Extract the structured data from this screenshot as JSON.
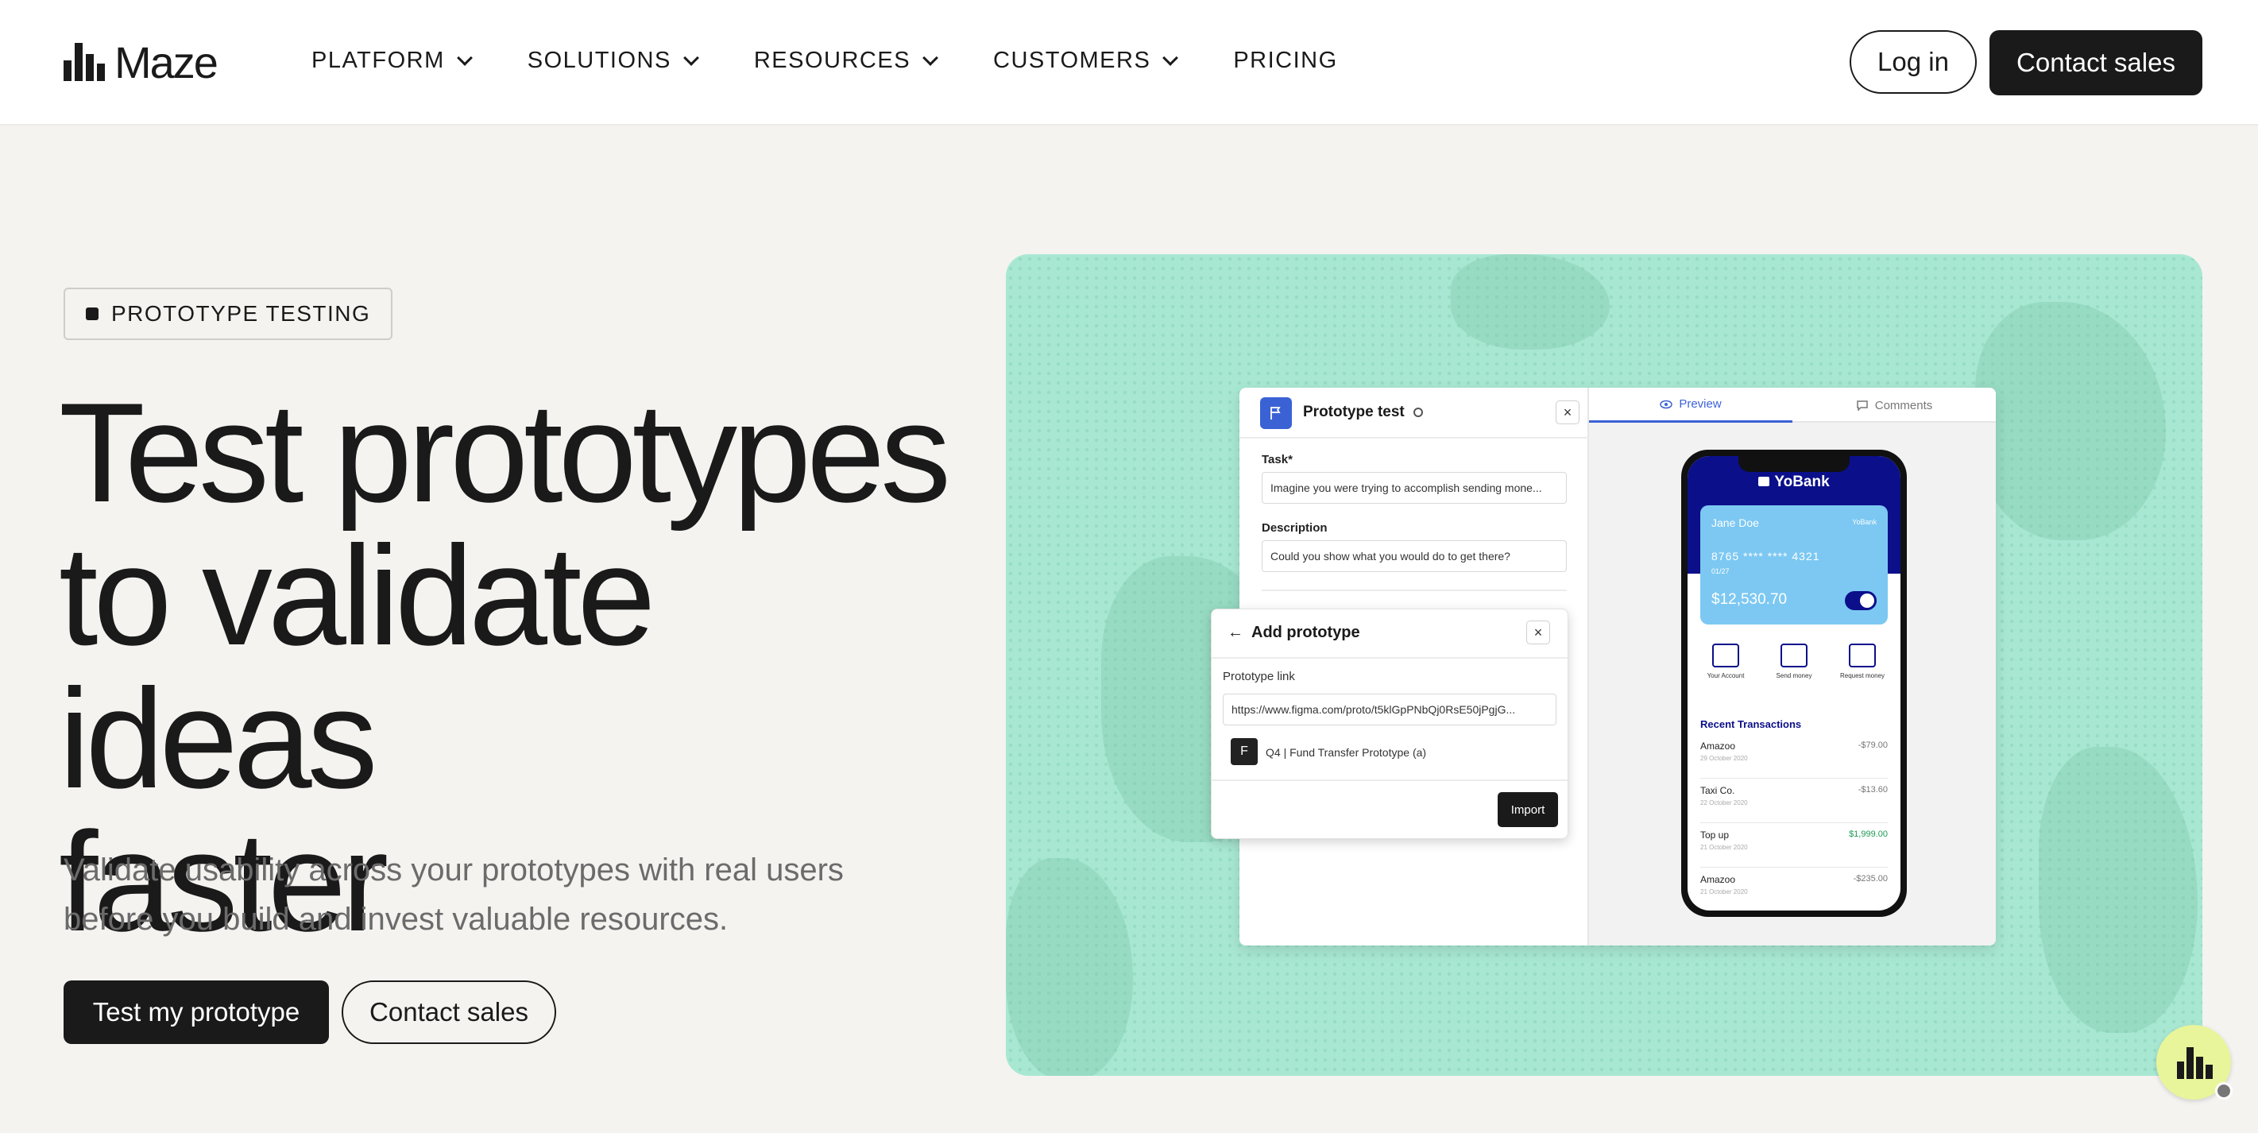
{
  "brand": {
    "name": "Maze"
  },
  "nav": {
    "items": [
      {
        "label": "PLATFORM",
        "has_dropdown": true
      },
      {
        "label": "SOLUTIONS",
        "has_dropdown": true
      },
      {
        "label": "RESOURCES",
        "has_dropdown": true
      },
      {
        "label": "CUSTOMERS",
        "has_dropdown": true
      },
      {
        "label": "PRICING",
        "has_dropdown": false
      }
    ],
    "login_label": "Log in",
    "contact_label": "Contact sales"
  },
  "hero": {
    "badge": "PROTOTYPE TESTING",
    "headline_lines": [
      "Test prototypes",
      "to validate ideas",
      "faster"
    ],
    "subtitle_lines": [
      "Validate usability across your prototypes with real users",
      "before you build and invest valuable resources."
    ],
    "primary_cta": "Test my prototype",
    "secondary_cta": "Contact sales"
  },
  "illustration": {
    "prototype_test": {
      "title": "Prototype test",
      "task_label": "Task*",
      "task_value": "Imagine you were trying to accomplish sending mone...",
      "description_label": "Description",
      "description_value": "Could you show what you would do to get there?"
    },
    "add_prototype": {
      "title": "Add prototype",
      "link_label": "Prototype link",
      "link_value": "https://www.figma.com/proto/t5klGpPNbQj0RsE50jPgjG...",
      "file_name": "Q4 | Fund Transfer Prototype (a)",
      "import_label": "Import"
    },
    "tabs": [
      {
        "label": "Preview",
        "active": true
      },
      {
        "label": "Comments",
        "active": false
      }
    ],
    "phone": {
      "bank_name": "YoBank",
      "card_holder": "Jane Doe",
      "card_brand": "YoBank",
      "card_number": "8765 **** **** 4321",
      "card_expiry": "01/27",
      "balance": "$12,530.70",
      "quick_actions": [
        "Your Account",
        "Send money",
        "Request money"
      ],
      "recent_title": "Recent Transactions",
      "transactions": [
        {
          "name": "Amazoo",
          "date": "29 October 2020",
          "amount": "-$79.00",
          "positive": false
        },
        {
          "name": "Taxi Co.",
          "date": "22 October 2020",
          "amount": "-$13.60",
          "positive": false
        },
        {
          "name": "Top up",
          "date": "21 October 2020",
          "amount": "$1,999.00",
          "positive": true
        },
        {
          "name": "Amazoo",
          "date": "21 October 2020",
          "amount": "-$235.00",
          "positive": false
        }
      ]
    }
  },
  "colors": {
    "background": "#f4f3f0",
    "ink": "#1a1a1a",
    "panel": "#a8e8d3",
    "accent_blue": "#3b62d4",
    "bank_navy": "#0b0f8a",
    "chat_fab": "#e8f59a"
  }
}
